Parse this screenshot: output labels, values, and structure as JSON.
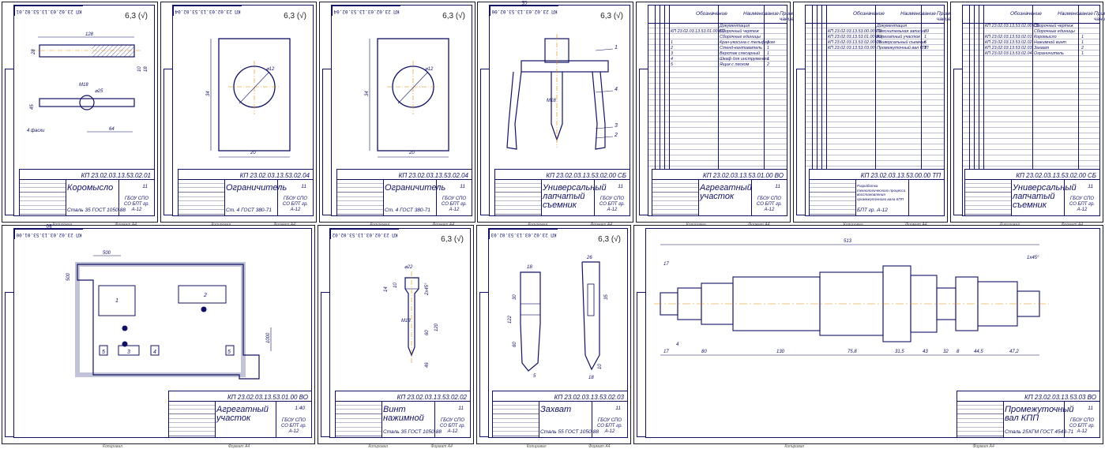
{
  "common": {
    "roughness": "6,3 (√)",
    "org": "ГБОУ СПО СО БПТ гр. А-12",
    "footer_copy": "Копировал",
    "footer_format": "Формат A4"
  },
  "sheets": [
    {
      "id": "s1",
      "stamp": "КП 23.02.03.13.53.02.01",
      "code": "КП 23.02.03.13.53.02.01",
      "name": "Коромысло",
      "material": "Сталь 35 ГОСТ 1050-88",
      "sheets": "11",
      "dims": [
        "128",
        "28",
        "М18",
        "⌀25",
        "45",
        "64",
        "4 фаски",
        "10",
        "18"
      ]
    },
    {
      "id": "s2",
      "stamp": "КП 23.02.03.13.53.02.04",
      "code": "КП 23.02.03.13.53.02.04",
      "name": "Ограничитель",
      "material": "Ст. 4 ГОСТ 380-71",
      "sheets": "11",
      "dims": [
        "⌀12",
        "20",
        "34"
      ]
    },
    {
      "id": "s3",
      "stamp": "КП 23.02.03.13.53.02.04",
      "code": "КП 23.02.03.13.53.02.04",
      "name": "Ограничитель",
      "material": "Ст. 4 ГОСТ 380-71",
      "sheets": "11",
      "dims": [
        "⌀12",
        "20",
        "34"
      ]
    },
    {
      "id": "s4",
      "stamp": "КП 23.02.03.13.53.02.00 СБ",
      "code": "КП 23.02.03.13.53.02.00 СБ",
      "name": "Универсальный лапчатый съемник",
      "material": "",
      "sheets": "11",
      "dims": [
        "М18",
        "1",
        "2",
        "3",
        "4"
      ]
    },
    {
      "id": "s5",
      "stamp": "",
      "code": "КП 23.02.03.13.53.01.00 ВО",
      "name": "Агрегатный участок",
      "material": "",
      "sheets": "11",
      "spec_head": [
        "Обозначение",
        "Наименование",
        "Приме-чание"
      ],
      "rows": [
        [
          "",
          "Документация",
          ""
        ],
        [
          "КП 23.02.03.13.53.01.00 ВО",
          "Сборочный чертеж",
          ""
        ],
        [
          "",
          "Сборочные единицы",
          ""
        ],
        [
          "1",
          "Кран-укосина с тельфером",
          "1"
        ],
        [
          "2",
          "Стенд-кантователь",
          "1"
        ],
        [
          "3",
          "Верстак слесарный",
          "1"
        ],
        [
          "4",
          "Шкаф для инструмента",
          "1"
        ],
        [
          "5",
          "Ящик с песком",
          "2"
        ]
      ]
    },
    {
      "id": "s6",
      "stamp": "",
      "code": "КП 23.02.03.13.53.00.00 ТП",
      "name": "Разработка технологического процесса восстановления промежуточного вала КПП",
      "material": "БПТ гр. А-12",
      "sheets": "",
      "spec_head": [
        "Обозначение",
        "Наименование",
        "Приме-чание"
      ],
      "rows": [
        [
          "",
          "Документация",
          ""
        ],
        [
          "КП 23.02.03.13.53.00.00 ПЗ",
          "Пояснительная записка",
          "39"
        ],
        [
          "КП 23.02.03.13.53.01.00 ВО",
          "Агрегатный участок",
          "1"
        ],
        [
          "КП 23.02.03.13.53.02.00 СБ",
          "Универсальный съемник",
          "5"
        ],
        [
          "КП 23.02.03.13.53.03.00",
          "Промежуточный вал КПП",
          "1"
        ]
      ]
    },
    {
      "id": "s7",
      "stamp": "",
      "code": "КП 23.02.03.13.53.02.00 СБ",
      "name": "Универсальный лапчатый съемник",
      "material": "",
      "sheets": "11",
      "spec_head": [
        "Обозначение",
        "Наименование",
        "Приме-чание"
      ],
      "rows": [
        [
          "КП 23.02.03.13.53.02.00 СБ",
          "Сборочный чертеж",
          ""
        ],
        [
          "",
          "Сборочные единицы",
          ""
        ],
        [
          "КП 23.02.03.13.53.02.01",
          "Коромысло",
          "1"
        ],
        [
          "КП 23.02.03.13.53.02.02",
          "Нажимной винт",
          "1"
        ],
        [
          "КП 23.02.03.13.53.02.03",
          "Захват",
          "2"
        ],
        [
          "КП 23.02.03.13.53.02.04",
          "Ограничитель",
          "1"
        ]
      ]
    },
    {
      "id": "s8",
      "stamp": "КП 23.02.03.13.53.01.00 ВО",
      "code": "КП 23.02.03.13.53.01.00 ВО",
      "name": "Агрегатный участок",
      "material": "",
      "sheets": "1:40",
      "dims": [
        "500",
        "500",
        "1000",
        "1",
        "2",
        "3",
        "4",
        "5",
        "5"
      ]
    },
    {
      "id": "s9",
      "stamp": "КП 23.02.03.13.53.02.02",
      "code": "КП 23.02.03.13.53.02.02",
      "name": "Винт нажимной",
      "material": "Сталь 35 ГОСТ 1050-88",
      "sheets": "11",
      "dims": [
        "⌀22",
        "М18",
        "120",
        "60",
        "14",
        "10",
        "2х45°",
        "46"
      ]
    },
    {
      "id": "s10",
      "stamp": "КП 23.02.03.13.53.02.03",
      "code": "КП 23.02.03.13.53.02.03",
      "name": "Захват",
      "material": "Сталь 55 ГОСТ 1050-88",
      "sheets": "11",
      "dims": [
        "18",
        "26",
        "35",
        "122",
        "60",
        "30",
        "5",
        "18",
        "10"
      ]
    },
    {
      "id": "s11",
      "stamp": "",
      "code": "КП 23.02.03.13.53.03 ВО",
      "name": "Промежуточный вал КПП",
      "material": "Сталь 25ХГМ ГОСТ 4543-71",
      "sheets": "11",
      "dims": [
        "513",
        "17",
        "80",
        "130",
        "75,8",
        "31,5",
        "43",
        "32",
        "8",
        "44,5",
        "47,2",
        "4",
        "1х45°",
        "17"
      ]
    }
  ]
}
